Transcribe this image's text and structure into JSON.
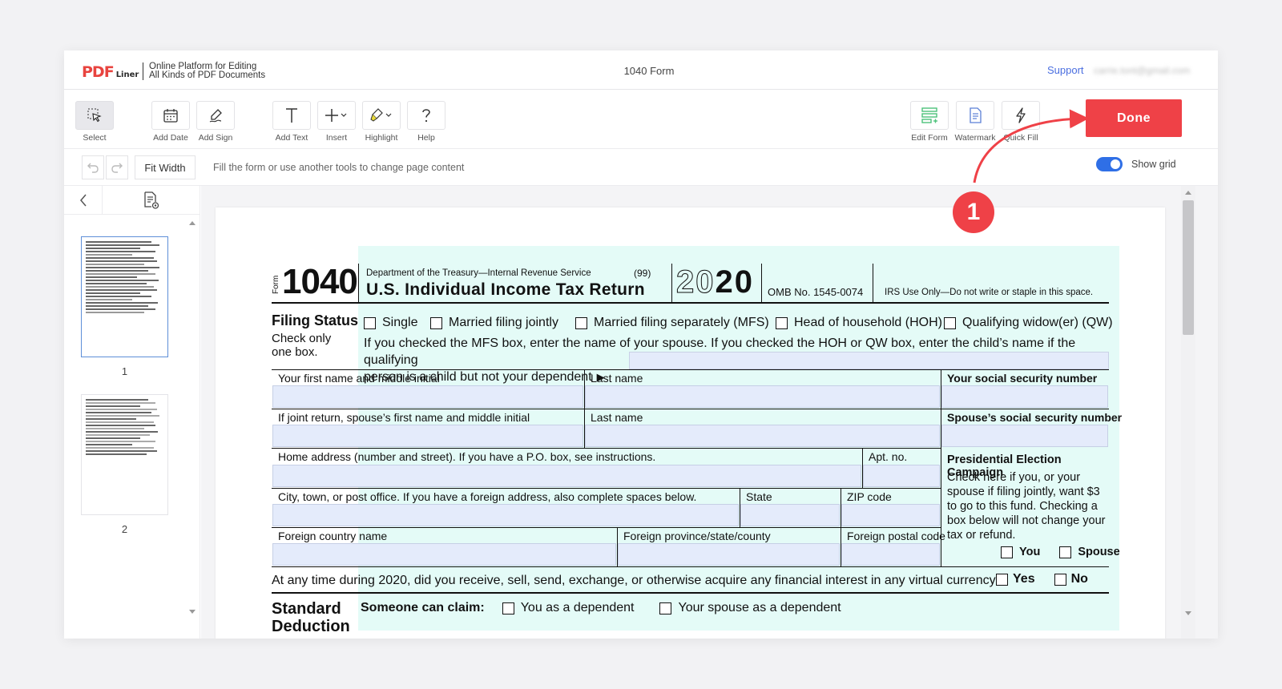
{
  "header": {
    "logo_main": "PDF",
    "logo_sub": "Liner",
    "tagline_line1": "Online Platform for Editing",
    "tagline_line2": "All Kinds of PDF Documents",
    "document_title": "1040 Form",
    "support_label": "Support",
    "user_email": "carrie.tont@gmail.com"
  },
  "toolbar": {
    "tools": [
      {
        "label": "Select",
        "icon": "select-cursor-icon"
      },
      {
        "label": "Add Date",
        "icon": "calendar-icon"
      },
      {
        "label": "Add Sign",
        "icon": "pen-sign-icon"
      },
      {
        "label": "Add Text",
        "icon": "text-t-icon"
      },
      {
        "label": "Insert",
        "icon": "plus-icon"
      },
      {
        "label": "Highlight",
        "icon": "highlighter-icon"
      },
      {
        "label": "Help",
        "icon": "question-icon"
      },
      {
        "label": "Edit Form",
        "icon": "edit-form-icon"
      },
      {
        "label": "Watermark",
        "icon": "watermark-icon"
      },
      {
        "label": "Quick Fill",
        "icon": "lightning-icon"
      }
    ],
    "done_label": "Done"
  },
  "subbar": {
    "fit_width_label": "Fit Width",
    "hint": "Fill the form or use another tools to change page content",
    "show_grid_label": "Show grid",
    "show_grid_on": true
  },
  "sidebar": {
    "pages": [
      {
        "number": "1",
        "selected": true
      },
      {
        "number": "2",
        "selected": false
      }
    ]
  },
  "annotation": {
    "step_number": "1",
    "color": "#ef4147"
  },
  "form": {
    "form_word": "Form",
    "form_number": "1040",
    "department": "Department of the Treasury—Internal Revenue Service",
    "code": "(99)",
    "title": "U.S. Individual Income Tax Return",
    "year_outline": "20",
    "year_bold": "20",
    "omb": "OMB No. 1545-0074",
    "irs_use": "IRS Use Only—Do not write or staple in this space.",
    "filing_status_title": "Filing Status",
    "filing_status_sub1": "Check only",
    "filing_status_sub2": "one box.",
    "filing_options": [
      "Single",
      "Married filing jointly",
      "Married filing separately (MFS)",
      "Head of household (HOH)",
      "Qualifying widow(er) (QW)"
    ],
    "filing_text_1": "If you checked the MFS box, enter the name of your spouse. If you checked the HOH or QW box, enter the child’s name if the qualifying",
    "filing_text_2": "person is a child but not your dependent",
    "fields": {
      "first_name": "Your first name and middle initial",
      "last_name": "Last name",
      "ssn": "Your social security number",
      "spouse_first": "If joint return, spouse’s first name and middle initial",
      "spouse_last": "Last name",
      "spouse_ssn": "Spouse’s social security number",
      "home_address": "Home address (number and street). If you have a P.O. box, see instructions.",
      "apt": "Apt. no.",
      "city": "City, town, or post office. If you have a foreign address, also complete spaces below.",
      "state": "State",
      "zip": "ZIP code",
      "foreign_country": "Foreign country name",
      "foreign_province": "Foreign province/state/county",
      "foreign_postal": "Foreign postal code"
    },
    "pec": {
      "title": "Presidential Election Campaign",
      "text": "Check here if you, or your spouse if filing jointly, want $3 to go to this fund. Checking a box below will not change your tax or refund.",
      "you": "You",
      "spouse": "Spouse"
    },
    "virtual_currency_q": "At any time during 2020, did you receive, sell, send, exchange, or otherwise acquire any financial interest in any virtual currency?",
    "yes": "Yes",
    "no": "No",
    "standard_title": "Standard",
    "standard_sub": "Deduction",
    "someone_can_claim": "Someone can claim:",
    "you_dependent": "You as a dependent",
    "spouse_dependent": "Your spouse as a dependent"
  }
}
